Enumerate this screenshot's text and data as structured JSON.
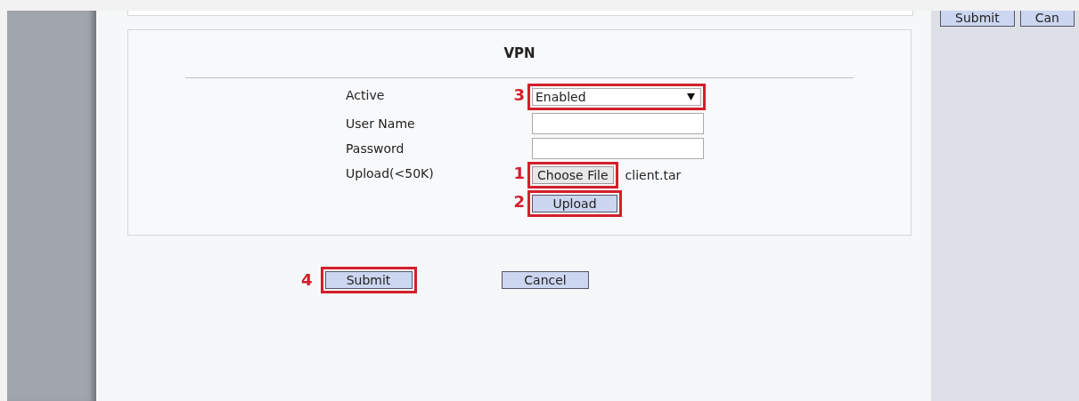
{
  "top_bar": {
    "buttons": [
      {
        "label": "Submit"
      },
      {
        "label": "Can"
      }
    ]
  },
  "vpn": {
    "title": "VPN",
    "fields": [
      {
        "kind": "select",
        "label": "Active",
        "value": "Enabled",
        "marker": "3"
      },
      {
        "kind": "text",
        "label": "User Name"
      },
      {
        "kind": "password",
        "label": "Password"
      },
      {
        "kind": "file",
        "label": "Upload(<50K)",
        "button": "Choose File",
        "filename": "client.tar",
        "marker": "1"
      },
      {
        "kind": "upload",
        "button": "Upload",
        "marker": "2"
      }
    ]
  },
  "actions": [
    {
      "label": "Submit",
      "marker": "4"
    },
    {
      "label": "Cancel"
    }
  ]
}
